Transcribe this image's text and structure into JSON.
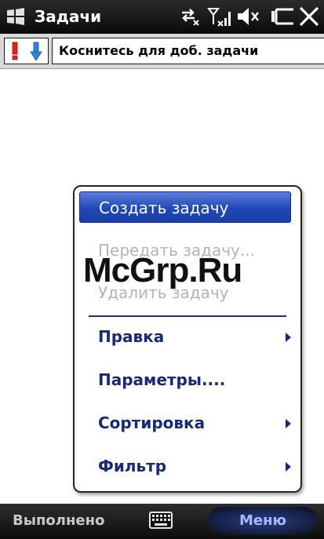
{
  "title_bar": {
    "title": "Задачи",
    "icons": [
      "windows-logo-icon",
      "data-connection-icon",
      "signal-icon",
      "volume-mute-icon",
      "battery-charging-icon",
      "close-icon"
    ]
  },
  "entry_bar": {
    "priority_icons": [
      "high-priority-icon",
      "low-priority-icon"
    ],
    "task_input_value": "Коснитесь для доб. задачи"
  },
  "menu": {
    "items": [
      {
        "label": "Создать задачу",
        "state": "selected"
      },
      {
        "label": "Передать задачу...",
        "state": "disabled"
      },
      {
        "label": "Удалить задачу",
        "state": "disabled"
      },
      {
        "label": "Правка",
        "state": "normal",
        "submenu": true
      },
      {
        "label": "Параметры....",
        "state": "normal"
      },
      {
        "label": "Сортировка",
        "state": "normal",
        "submenu": true
      },
      {
        "label": "Фильтр",
        "state": "normal",
        "submenu": true
      }
    ]
  },
  "watermark": "McGrp.Ru",
  "soft_keys": {
    "left": "Выполнено",
    "center_icon": "keyboard-icon",
    "right": "Меню"
  },
  "colors": {
    "menu_text": "#172a7a",
    "selected_bg": "#1f48b7",
    "disabled_text": "#b4b4b4",
    "title_bar_bg": "#111111"
  }
}
